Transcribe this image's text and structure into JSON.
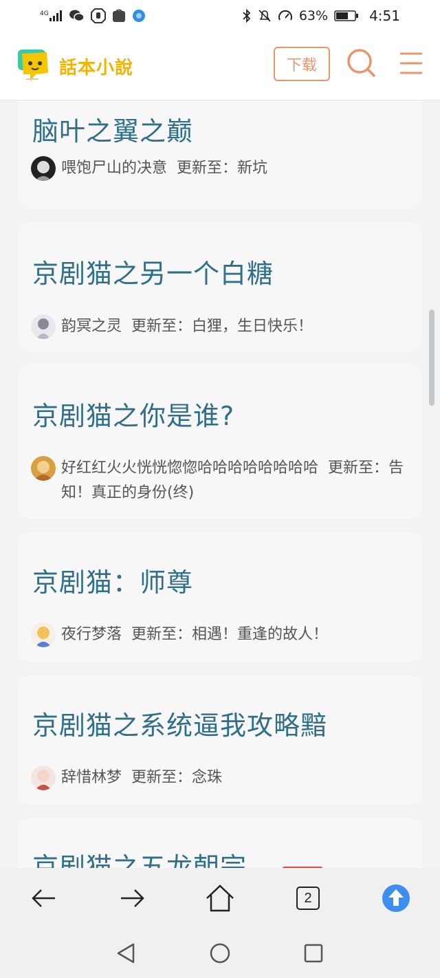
{
  "status_bar": {
    "network": "4G",
    "battery_percent": "63%",
    "time": "4:51"
  },
  "app_header": {
    "logo_text": "話本小說",
    "download_label": "下载"
  },
  "books": [
    {
      "title": "脑叶之翼之巅",
      "author": "喂饱尸山的决意",
      "update": "更新至：新坑"
    },
    {
      "title": "京剧猫之另一个白糖",
      "author": "韵冥之灵",
      "update": "更新至：白狸，生日快乐！"
    },
    {
      "title": "京剧猫之你是谁?",
      "author": "好红红火火恍恍惚惚哈哈哈哈哈哈哈哈",
      "update": "更新至：告知！真正的身份(终)"
    },
    {
      "title": "京剧猫：师尊",
      "author": "夜行梦落",
      "update": "更新至：相遇！重逢的故人！"
    },
    {
      "title": "京剧猫之系统逼我攻略黯",
      "author": "辞惜林梦",
      "update": "更新至：念珠"
    },
    {
      "title": "京剧猫之五龙朝宗",
      "author": "",
      "update": ""
    }
  ],
  "browser_bar": {
    "tab_count": "2"
  },
  "colors": {
    "title": "#2f6f8a",
    "accent_orange": "#e9956a",
    "logo_yellow": "#f0b400",
    "upload_blue": "#3d8ef0"
  }
}
